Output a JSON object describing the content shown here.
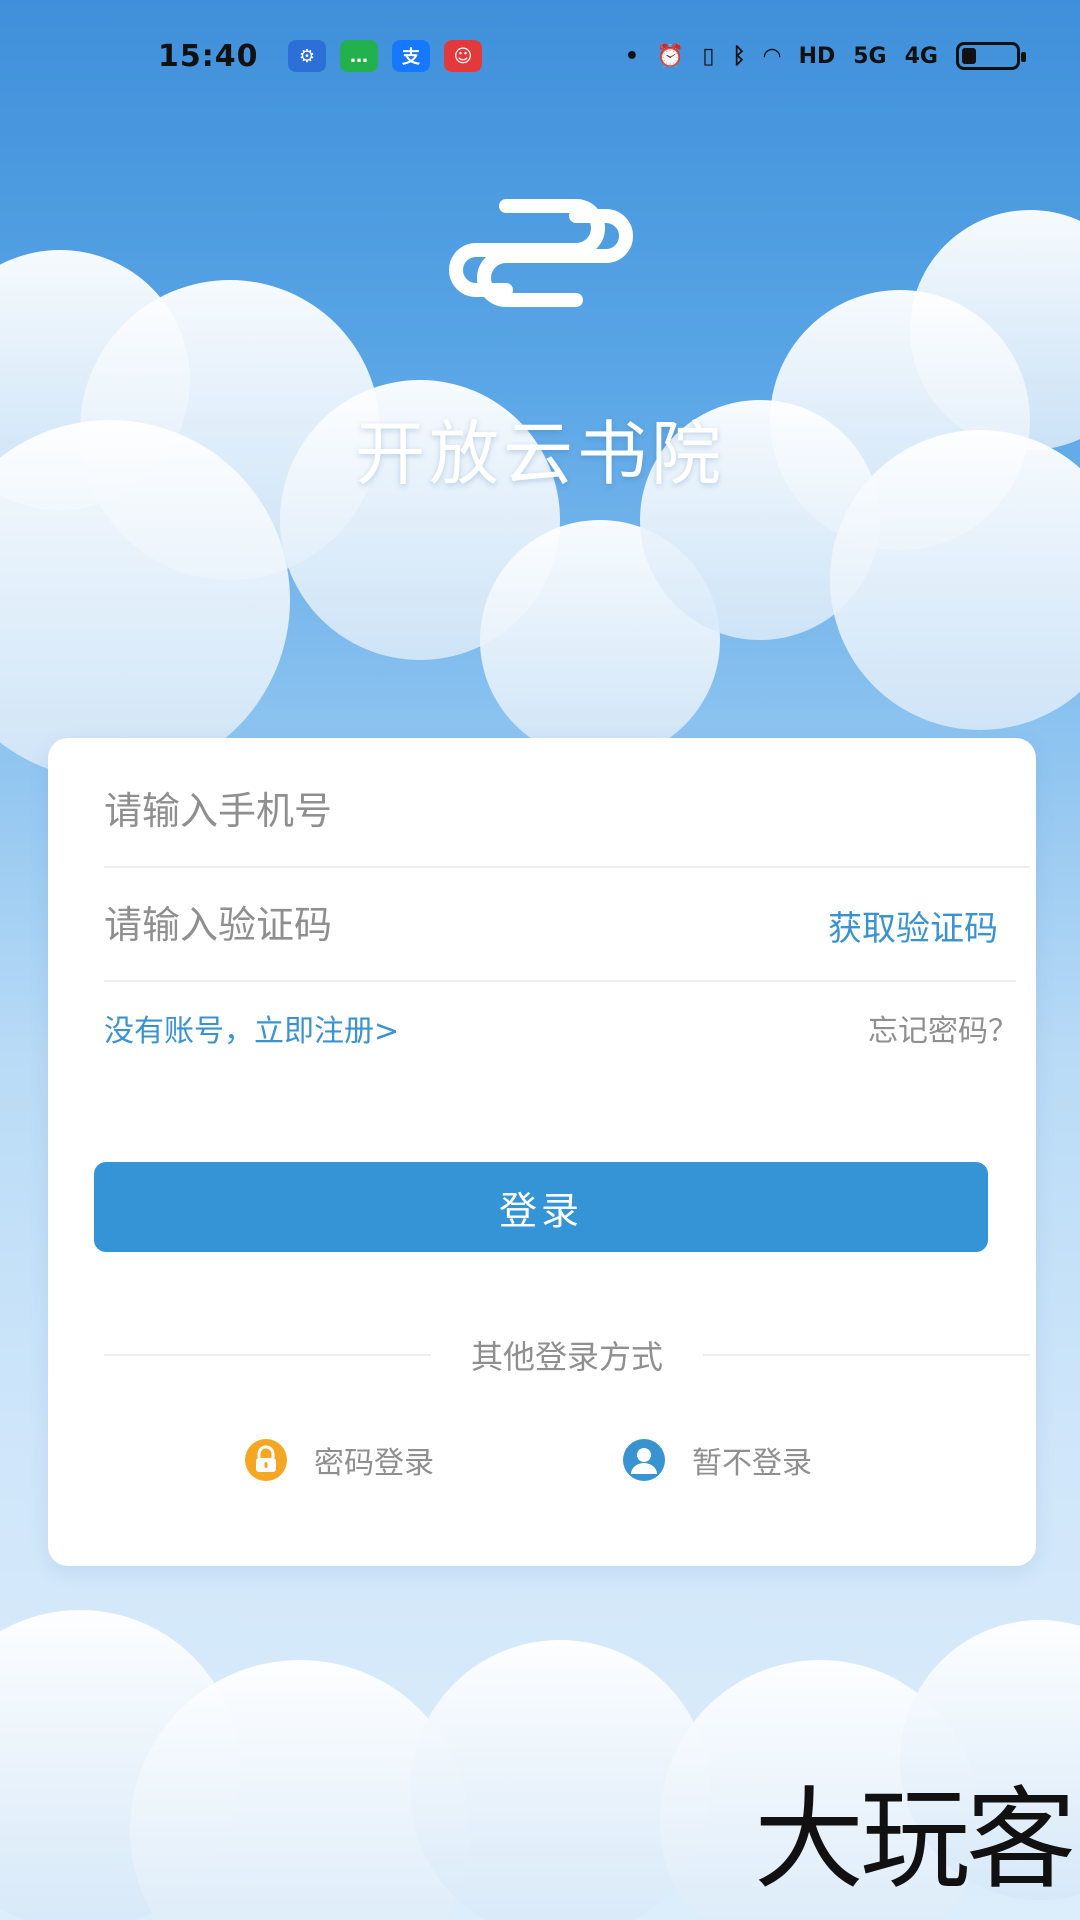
{
  "status_bar": {
    "time": "15:40",
    "apps": [
      {
        "icon": "metro-app-icon",
        "color": "#2c6fd6",
        "glyph": "⚙"
      },
      {
        "icon": "message-app-icon",
        "color": "#22b14c",
        "glyph": "…"
      },
      {
        "icon": "alipay-app-icon",
        "color": "#1677ff",
        "glyph": "支"
      },
      {
        "icon": "jd-app-icon",
        "color": "#e4393c",
        "glyph": "☺"
      }
    ],
    "hd_label": "HD",
    "net_5g": "5G",
    "net_4g": "4G"
  },
  "app": {
    "title": "开放云书院"
  },
  "form": {
    "phone_placeholder": "请输入手机号",
    "code_placeholder": "请输入验证码",
    "get_code_label": "获取验证码",
    "register_label": "没有账号，立即注册>",
    "forgot_label": "忘记密码？",
    "login_label": "登录"
  },
  "other_login": {
    "title": "其他登录方式",
    "password_login": "密码登录",
    "guest_login": "暂不登录"
  },
  "colors": {
    "accent": "#3594d6",
    "link": "#3a93d1",
    "lock_icon": "#f5a623",
    "user_icon": "#3a93d1"
  },
  "watermark": "大玩客"
}
